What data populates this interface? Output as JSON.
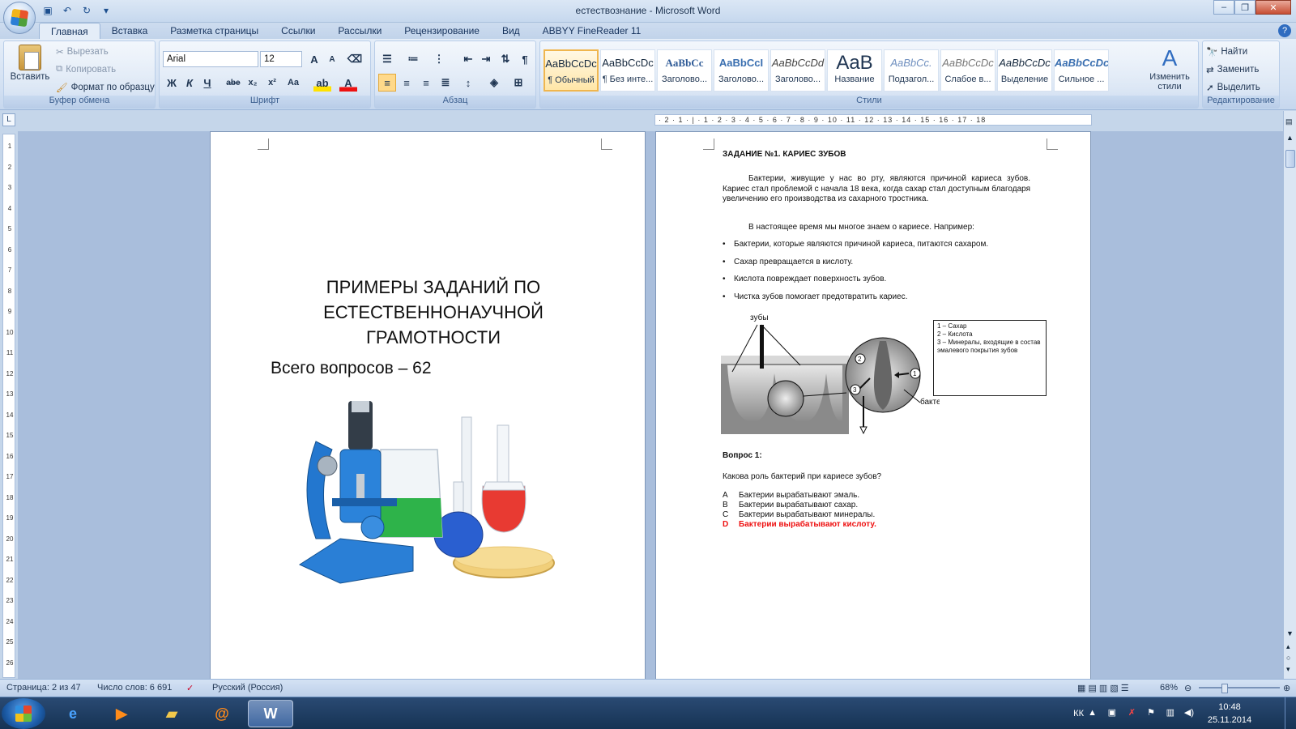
{
  "window": {
    "title": "естествознание - Microsoft Word",
    "controls": [
      "minimize",
      "maximize",
      "close"
    ]
  },
  "qat": [
    "save-icon",
    "undo-icon",
    "redo-icon",
    "customize-icon"
  ],
  "ribbon": {
    "tabs": [
      "Главная",
      "Вставка",
      "Разметка страницы",
      "Ссылки",
      "Рассылки",
      "Рецензирование",
      "Вид",
      "ABBYY FineReader 11"
    ],
    "active_tab": "Главная",
    "clipboard": {
      "paste": "Вставить",
      "cut": "Вырезать",
      "copy": "Копировать",
      "format_painter": "Формат по образцу",
      "label": "Буфер обмена"
    },
    "font": {
      "family": "Arial",
      "size": "12",
      "label": "Шрифт",
      "bold": "Ж",
      "italic": "К",
      "underline": "Ч",
      "strike": "abe",
      "subscript": "x₂",
      "superscript": "x²",
      "case": "Aa",
      "grow": "A",
      "shrink": "A",
      "font_color": "A"
    },
    "paragraph": {
      "label": "Абзац"
    },
    "styles": {
      "label": "Стили",
      "items": [
        {
          "preview": "AaBbCcDc",
          "name": "¶ Обычный",
          "selected": true
        },
        {
          "preview": "AaBbCcDc",
          "name": "¶ Без инте..."
        },
        {
          "preview": "AaBbCc",
          "name": "Заголово..."
        },
        {
          "preview": "AaBbCcI",
          "name": "Заголово..."
        },
        {
          "preview": "AaBbCcDd",
          "name": "Заголово..."
        },
        {
          "preview": "AaB",
          "name": "Название"
        },
        {
          "preview": "AaBbCc.",
          "name": "Подзагол..."
        },
        {
          "preview": "AaBbCcDc",
          "name": "Слабое в..."
        },
        {
          "preview": "AaBbCcDc",
          "name": "Выделение"
        },
        {
          "preview": "AaBbCcDc",
          "name": "Сильное ..."
        }
      ],
      "change": "Изменить стили"
    },
    "editing": {
      "label": "Редактирование",
      "find": "Найти",
      "replace": "Заменить",
      "select": "Выделить"
    }
  },
  "ruler": {
    "h_ticks": "· 2 · 1 · | · 1 · 2 · 3 · 4 · 5 · 6 · 7 · 8 · 9 · 10 · 11 · 12 · 13 · 14 · 15 · 16 · 17 · 18",
    "v_ticks": [
      "1",
      "2",
      "3",
      "4",
      "5",
      "6",
      "7",
      "8",
      "9",
      "10",
      "11",
      "12",
      "13",
      "14",
      "15",
      "16",
      "17",
      "18",
      "19",
      "20",
      "21",
      "22",
      "23",
      "24",
      "25",
      "26"
    ]
  },
  "page1": {
    "title": "ПРИМЕРЫ ЗАДАНИЙ ПО ЕСТЕСТВЕННОНАУЧНОЙ ГРАМОТНОСТИ",
    "subtitle": "Всего вопросов – 62"
  },
  "page2": {
    "heading": "ЗАДАНИЕ №1. КАРИЕС ЗУБОВ",
    "para1": "Бактерии, живущие у нас во рту, являются причиной кариеса зубов. Кариес стал проблемой с начала 18 века, когда сахар стал доступным благодаря увеличению его производства из сахарного тростника.",
    "para2": "В настоящее время мы многое знаем о кариесе. Например:",
    "bullets": [
      "Бактерии, которые являются причиной кариеса, питаются сахаром.",
      "Сахар превращается в кислоту.",
      "Кислота повреждает поверхность зубов.",
      "Чистка зубов помогает предотвратить кариес."
    ],
    "diagram": {
      "teeth_label": "зубы",
      "bacteria_label": "бактерия",
      "markers": [
        "1",
        "2",
        "3"
      ],
      "legend": [
        "1 – Сахар",
        "2 – Кислота",
        "3 – Минералы, входящие в состав эмалевого покрытия зубов"
      ]
    },
    "question_label": "Вопрос 1:",
    "question": "Какова роль бактерий при кариесе зубов?",
    "answers": [
      {
        "key": "A",
        "text": "Бактерии вырабатывают эмаль."
      },
      {
        "key": "B",
        "text": "Бактерии вырабатывают сахар."
      },
      {
        "key": "C",
        "text": "Бактерии вырабатывают минералы."
      },
      {
        "key": "D",
        "text": "Бактерии вырабатывают кислоту.",
        "correct": true
      }
    ]
  },
  "status": {
    "page": "Страница: 2 из 47",
    "words": "Число слов: 6 691",
    "lang": "Русский (Россия)",
    "zoom": "68%"
  },
  "taskbar": {
    "apps": [
      "explorer-icon",
      "ie-icon",
      "media-player-icon",
      "folder-icon",
      "mail-icon",
      "word-icon"
    ],
    "lang": "КК",
    "time": "10:48",
    "date": "25.11.2014"
  },
  "colors": {
    "answer_correct": "#e11111",
    "ribbon_bg": "#d2e0f2",
    "doc_bg": "#a9bedc"
  }
}
